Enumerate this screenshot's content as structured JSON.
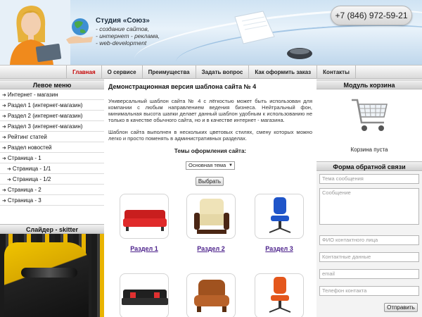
{
  "header": {
    "studio_title": "Студия «Союз»",
    "taglines": [
      "- создание сайтов,",
      "- интернет - реклама,",
      "- web-development"
    ],
    "phone": "+7 (846) 972-59-21"
  },
  "topnav": [
    {
      "label": "Главная",
      "active": true
    },
    {
      "label": "О сервисе",
      "active": false
    },
    {
      "label": "Преимущества",
      "active": false
    },
    {
      "label": "Задать вопрос",
      "active": false
    },
    {
      "label": "Как оформить заказ",
      "active": false
    },
    {
      "label": "Контакты",
      "active": false
    }
  ],
  "left_menu": {
    "title": "Левое меню",
    "items": [
      {
        "label": "Интернет - магазин",
        "sub": false
      },
      {
        "label": "Раздел 1 (интернет-магазин)",
        "sub": false
      },
      {
        "label": "Раздел 2 (интернет-магазин)",
        "sub": false
      },
      {
        "label": "Раздел 3 (интернет-магазин)",
        "sub": false
      },
      {
        "label": "Рейтинг статей",
        "sub": false
      },
      {
        "label": "Раздел новостей",
        "sub": false
      },
      {
        "label": "Страница - 1",
        "sub": false
      },
      {
        "label": "Страница - 1/1",
        "sub": true
      },
      {
        "label": "Страница - 1/2",
        "sub": true
      },
      {
        "label": "Страница - 2",
        "sub": false
      },
      {
        "label": "Страница - 3",
        "sub": false
      }
    ]
  },
  "slider": {
    "title": "Слайдер - skitter"
  },
  "main": {
    "title": "Демонстрационная версия шаблона сайта № 4",
    "para1": "Универсальный шаблон сайта № 4 с лёгкостью может быть использован для компании с любым направлением ведения бизнеса. Нейтральный фон, минимальная высота шапки делает данный шаблон удобным к использованию не только в качестве обычного сайта, но и в качестве интернет - магазина.",
    "para2": "Шаблон сайта выполнен в нескольких цветовых стилях, смену которых можно легко и просто поменять в административных разделах.",
    "themes_label": "Темы оформления сайта:",
    "theme_selected": "Основная тема",
    "choose_button": "Выбрать",
    "sections": [
      "Раздел 1",
      "Раздел 2",
      "Раздел 3"
    ]
  },
  "cart": {
    "title": "Модуль корзина",
    "status": "Корзина пуста"
  },
  "feedback": {
    "title": "Форма обратной связи",
    "placeholders": [
      "Тема сообщения",
      "Сообщение",
      "ФИО контактного лица",
      "Контактные данные",
      "email",
      "Телефон контакта"
    ],
    "send_button": "Отправить"
  },
  "colors": {
    "nav_active": "#c40000",
    "section_link": "#4a1f8a",
    "header_blue": "#cfe3f3"
  }
}
